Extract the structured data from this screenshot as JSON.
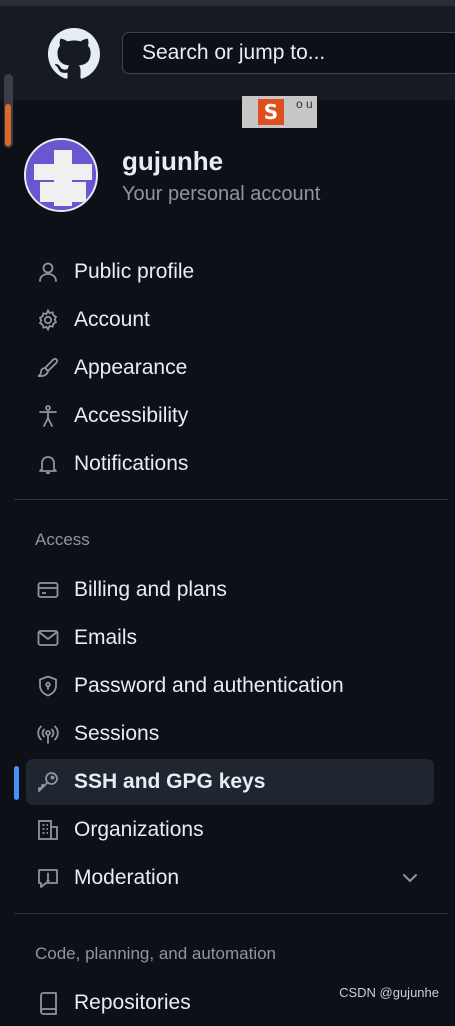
{
  "header": {
    "search_placeholder": "Search or jump to...",
    "extension_badge_icon": "extension-s-icon",
    "extension_badge_text": "o u"
  },
  "account": {
    "username": "gujunhe",
    "subtitle": "Your personal account"
  },
  "nav": {
    "items": [
      {
        "label": "Public profile",
        "icon": "person-icon"
      },
      {
        "label": "Account",
        "icon": "gear-icon"
      },
      {
        "label": "Appearance",
        "icon": "paintbrush-icon"
      },
      {
        "label": "Accessibility",
        "icon": "accessibility-icon"
      },
      {
        "label": "Notifications",
        "icon": "bell-icon"
      }
    ],
    "access_heading": "Access",
    "access_items": [
      {
        "label": "Billing and plans",
        "icon": "credit-card-icon"
      },
      {
        "label": "Emails",
        "icon": "mail-icon"
      },
      {
        "label": "Password and authentication",
        "icon": "shield-lock-icon"
      },
      {
        "label": "Sessions",
        "icon": "broadcast-icon"
      },
      {
        "label": "SSH and GPG keys",
        "icon": "key-icon",
        "active": true
      },
      {
        "label": "Organizations",
        "icon": "organization-icon"
      },
      {
        "label": "Moderation",
        "icon": "report-icon",
        "expandable": true
      }
    ],
    "code_heading": "Code, planning, and automation",
    "code_items": [
      {
        "label": "Repositories",
        "icon": "repo-icon"
      }
    ]
  },
  "watermark": "CSDN @gujunhe",
  "colors": {
    "background": "#0d1117",
    "header": "#161b22",
    "accent": "#4493f8",
    "muted_text": "#8d96a0",
    "active_bg": "#1f2630"
  }
}
